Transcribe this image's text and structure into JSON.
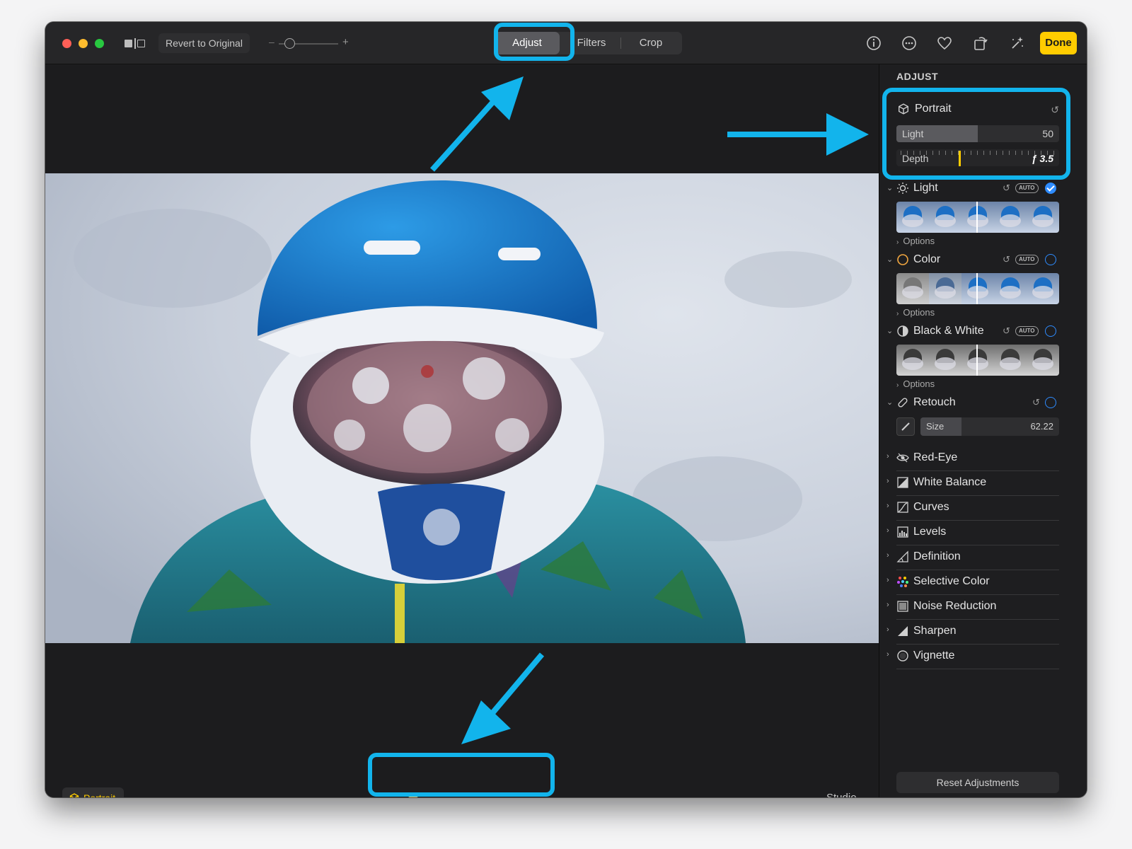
{
  "toolbar": {
    "revert_label": "Revert to Original",
    "tabs": [
      {
        "label": "Adjust",
        "selected": true
      },
      {
        "label": "Filters",
        "selected": false
      },
      {
        "label": "Crop",
        "selected": false
      }
    ],
    "done_label": "Done",
    "icons": [
      "info-icon",
      "more-icon",
      "heart-icon",
      "rotate-icon",
      "magic-wand-icon"
    ]
  },
  "photo": {
    "portrait_badge": "Portrait",
    "lighting_mode_label": "Studio",
    "lighting_options": [
      "natural-light",
      "studio-light",
      "contour-light",
      "stage-light",
      "stage-light-mono",
      "high-key-light-mono"
    ],
    "selected_lighting": "studio-light"
  },
  "sidebar": {
    "title": "ADJUST",
    "portrait": {
      "label": "Portrait",
      "light_label": "Light",
      "light_value": "50",
      "light_fraction": 0.5,
      "depth_label": "Depth",
      "depth_value": "ƒ 3.5"
    },
    "light": {
      "label": "Light",
      "auto": "AUTO",
      "enabled": true,
      "options": "Options"
    },
    "color": {
      "label": "Color",
      "auto": "AUTO",
      "enabled": false,
      "options": "Options"
    },
    "bw": {
      "label": "Black & White",
      "auto": "AUTO",
      "enabled": false,
      "options": "Options"
    },
    "retouch": {
      "label": "Retouch",
      "size_label": "Size",
      "size_value": "62.22",
      "enabled": false
    },
    "items": [
      {
        "label": "Red-Eye",
        "icon": "eye-icon"
      },
      {
        "label": "White Balance",
        "icon": "white-balance-icon"
      },
      {
        "label": "Curves",
        "icon": "curves-icon"
      },
      {
        "label": "Levels",
        "icon": "levels-icon"
      },
      {
        "label": "Definition",
        "icon": "definition-icon"
      },
      {
        "label": "Selective Color",
        "icon": "selective-color-icon"
      },
      {
        "label": "Noise Reduction",
        "icon": "noise-reduction-icon"
      },
      {
        "label": "Sharpen",
        "icon": "sharpen-icon"
      },
      {
        "label": "Vignette",
        "icon": "vignette-icon"
      }
    ],
    "reset_label": "Reset Adjustments"
  },
  "colors": {
    "accent_yellow": "#ffcc00",
    "annotation_cyan": "#12b4ec",
    "check_blue": "#2f8cff"
  }
}
